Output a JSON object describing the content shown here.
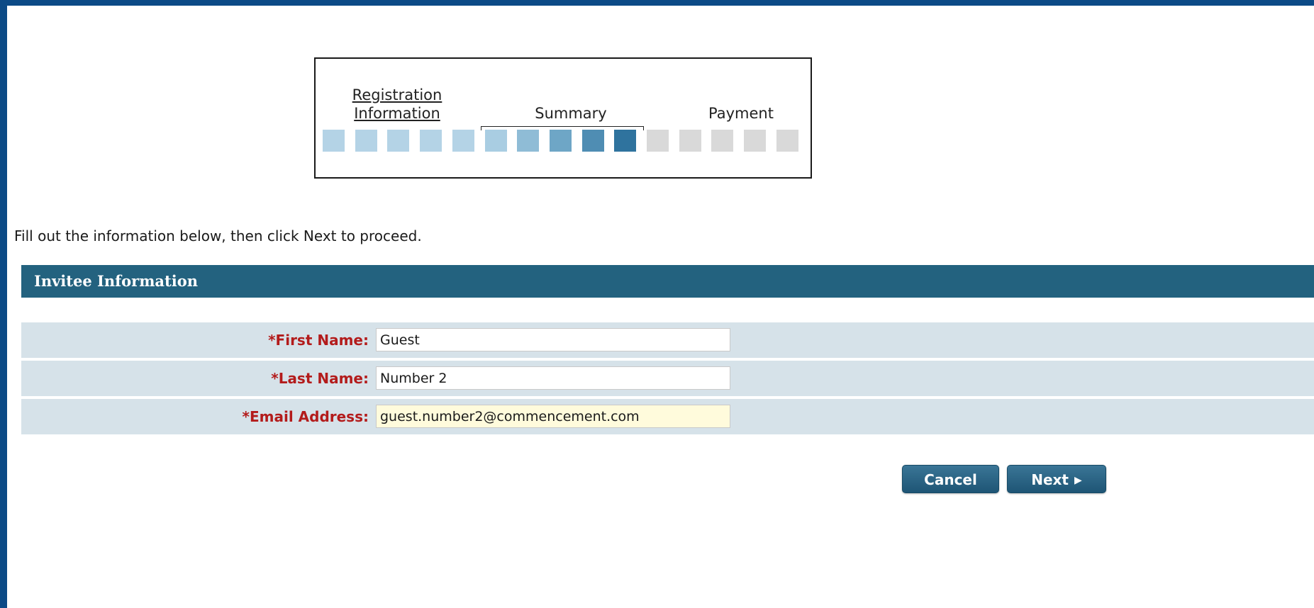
{
  "progress": {
    "steps": [
      {
        "label_line1": "Registration",
        "label_line2": "Information"
      },
      {
        "label": "Summary"
      },
      {
        "label": "Payment"
      }
    ],
    "square_colors": [
      "#b4d3e6",
      "#b4d3e6",
      "#b4d3e6",
      "#b4d3e6",
      "#b4d3e6",
      "#a9cde2",
      "#8fbcd6",
      "#6ea6c6",
      "#4f8db3",
      "#2f739e",
      "#d9d9d9",
      "#d9d9d9",
      "#d9d9d9",
      "#d9d9d9",
      "#d9d9d9"
    ]
  },
  "instructions": "Fill out the information below, then click Next to proceed.",
  "section": {
    "title": "Invitee Information"
  },
  "form": {
    "first_name": {
      "label": "*First Name:",
      "value": "Guest"
    },
    "last_name": {
      "label": "*Last Name:",
      "value": "Number 2"
    },
    "email": {
      "label": "*Email Address:",
      "value": "guest.number2@commencement.com"
    }
  },
  "buttons": {
    "cancel": "Cancel",
    "next": "Next",
    "next_icon": "▶"
  },
  "colors": {
    "border": "#0c4a86",
    "header": "#23627f",
    "required_label": "#b31b1b",
    "row_bg": "#d6e2e9",
    "active_input": "#fffbdc"
  }
}
